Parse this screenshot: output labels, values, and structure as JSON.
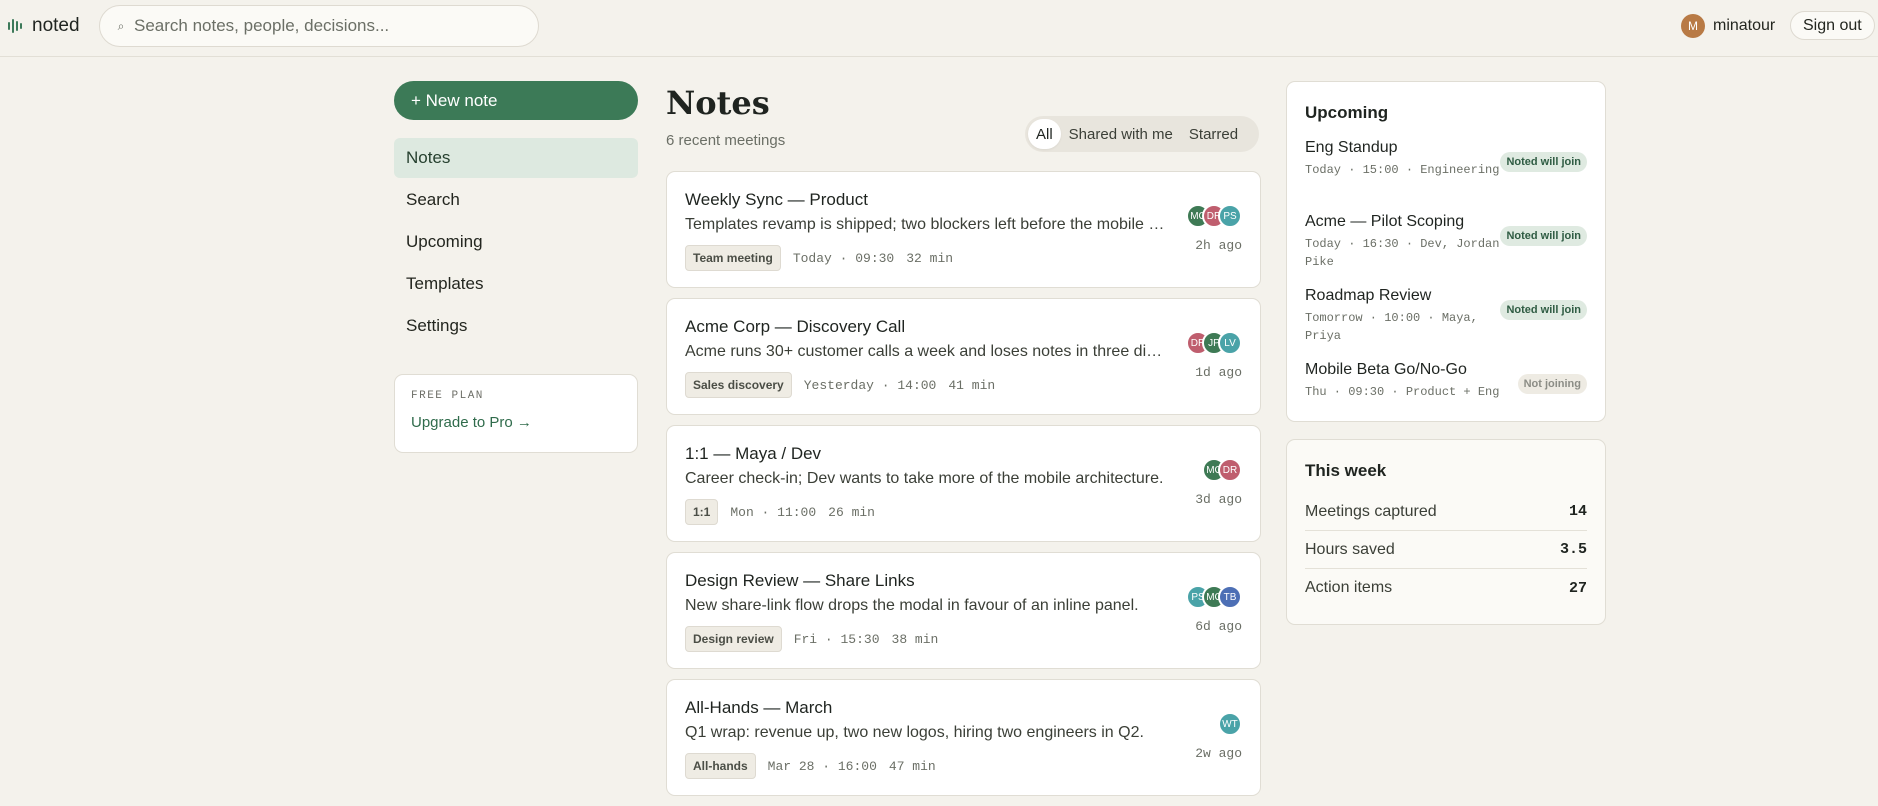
{
  "app": {
    "name": "noted"
  },
  "search": {
    "placeholder": "Search notes, people, decisions..."
  },
  "user": {
    "initial": "M",
    "name": "minatour",
    "sign_out": "Sign out"
  },
  "sidebar": {
    "new_note": "+ New note",
    "items": [
      {
        "label": "Notes",
        "active": true
      },
      {
        "label": "Search"
      },
      {
        "label": "Upcoming"
      },
      {
        "label": "Templates"
      },
      {
        "label": "Settings"
      }
    ],
    "plan": {
      "label": "FREE PLAN",
      "link": "Upgrade to Pro →"
    }
  },
  "main": {
    "title": "Notes",
    "subtitle": "6 recent meetings",
    "filters": [
      {
        "label": "All",
        "active": true
      },
      {
        "label": "Shared with me"
      },
      {
        "label": "Starred"
      }
    ],
    "notes": [
      {
        "title": "Weekly Sync — Product",
        "summary": "Templates revamp is shipped; two blockers left before the mobile b...",
        "tag": "Team meeting",
        "when": "Today · 09:30",
        "duration": "32 min",
        "ago": "2h ago",
        "people": [
          {
            "initials": "MC",
            "color": "#3e7a55"
          },
          {
            "initials": "DR",
            "color": "#bf5e6e"
          },
          {
            "initials": "PS",
            "color": "#4aa3a8"
          }
        ]
      },
      {
        "title": "Acme Corp — Discovery Call",
        "summary": "Acme runs 30+ customer calls a week and loses notes in three diff...",
        "tag": "Sales discovery",
        "when": "Yesterday · 14:00",
        "duration": "41 min",
        "ago": "1d ago",
        "people": [
          {
            "initials": "DR",
            "color": "#bf5e6e"
          },
          {
            "initials": "JP",
            "color": "#3e7a55"
          },
          {
            "initials": "LV",
            "color": "#4aa3a8"
          }
        ]
      },
      {
        "title": "1:1 — Maya / Dev",
        "summary": "Career check-in; Dev wants to take more of the mobile architecture.",
        "tag": "1:1",
        "when": "Mon · 11:00",
        "duration": "26 min",
        "ago": "3d ago",
        "people": [
          {
            "initials": "MC",
            "color": "#3e7a55"
          },
          {
            "initials": "DR",
            "color": "#bf5e6e"
          }
        ]
      },
      {
        "title": "Design Review — Share Links",
        "summary": "New share-link flow drops the modal in favour of an inline panel.",
        "tag": "Design review",
        "when": "Fri · 15:30",
        "duration": "38 min",
        "ago": "6d ago",
        "people": [
          {
            "initials": "PS",
            "color": "#4aa3a8"
          },
          {
            "initials": "MC",
            "color": "#3e7a55"
          },
          {
            "initials": "TB",
            "color": "#4d6fb5"
          }
        ]
      },
      {
        "title": "All-Hands — March",
        "summary": "Q1 wrap: revenue up, two new logos, hiring two engineers in Q2.",
        "tag": "All-hands",
        "when": "Mar 28 · 16:00",
        "duration": "47 min",
        "ago": "2w ago",
        "people": [
          {
            "initials": "WT",
            "color": "#4aa3a8"
          }
        ]
      }
    ]
  },
  "upcoming": {
    "title": "Upcoming",
    "items": [
      {
        "name": "Eng Standup",
        "meta": "Today · 15:00 · Engineering",
        "status": "Noted will join",
        "joining": true
      },
      {
        "name": "Acme — Pilot Scoping",
        "meta": "Today · 16:30 · Dev, Jordan Pike",
        "status": "Noted will join",
        "joining": true
      },
      {
        "name": "Roadmap Review",
        "meta": "Tomorrow · 10:00 · Maya, Priya",
        "status": "Noted will join",
        "joining": true
      },
      {
        "name": "Mobile Beta Go/No-Go",
        "meta": "Thu · 09:30 · Product + Eng",
        "status": "Not joining",
        "joining": false
      }
    ]
  },
  "this_week": {
    "title": "This week",
    "stats": [
      {
        "label": "Meetings captured",
        "value": "14"
      },
      {
        "label": "Hours saved",
        "value": "3.5"
      },
      {
        "label": "Action items",
        "value": "27"
      }
    ]
  }
}
